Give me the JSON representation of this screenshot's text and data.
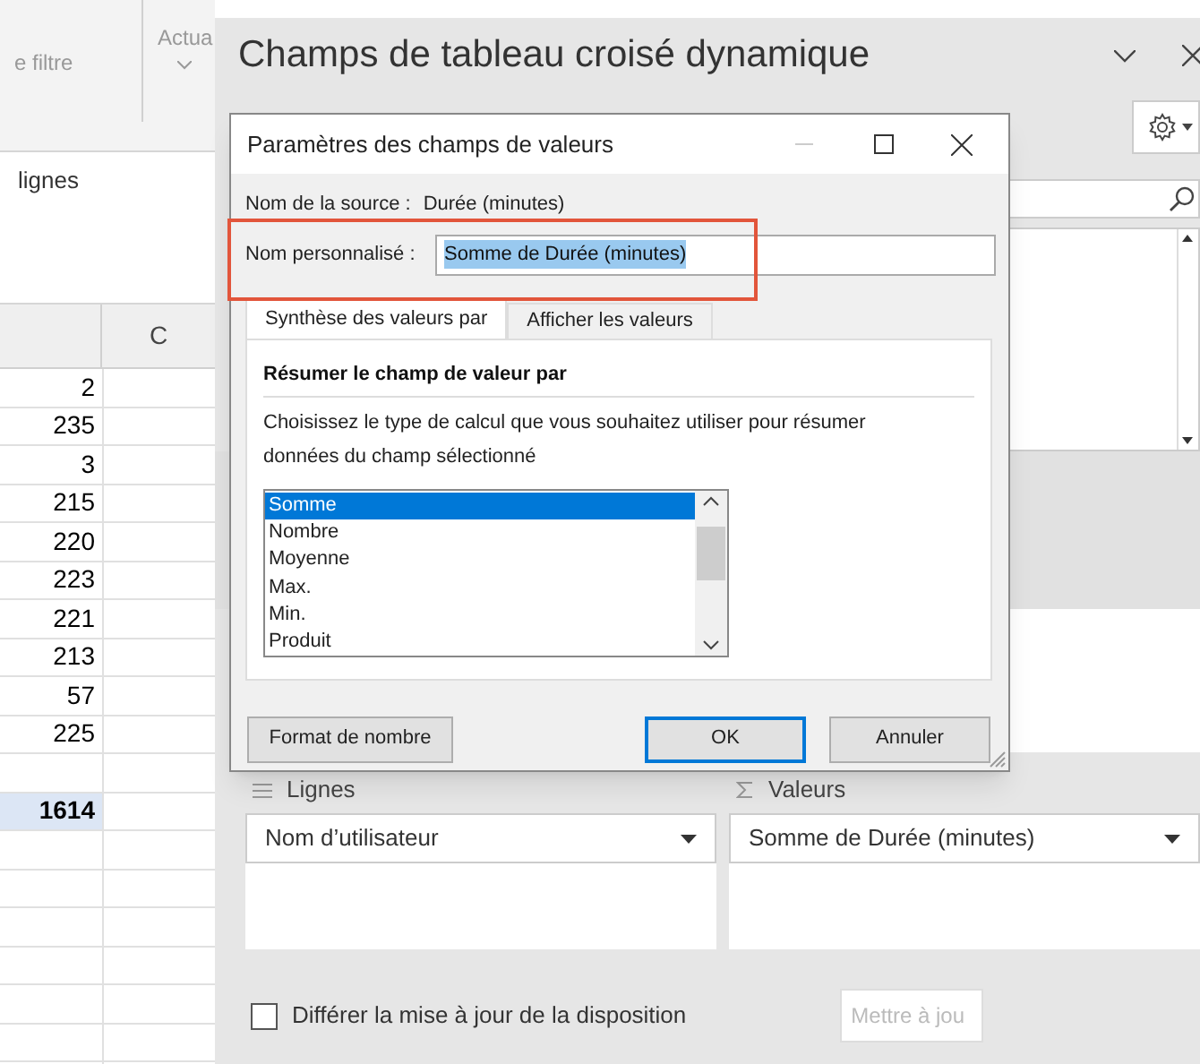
{
  "ribbon": {
    "items": [
      {
        "kind": "text",
        "label": "e filtre"
      },
      {
        "kind": "dropdown",
        "label": "Actua"
      }
    ]
  },
  "sheet": {
    "label": "lignes",
    "column_header": "C",
    "rows": [
      "2",
      "235",
      "3",
      "215",
      "220",
      "223",
      "221",
      "213",
      "57",
      "225"
    ],
    "total": "1614"
  },
  "pivot_pane": {
    "title": "Champs de tableau croisé dynamique",
    "areas": [
      {
        "kind": "rows",
        "header": "Lignes",
        "field": "Nom d’utilisateur"
      },
      {
        "kind": "values",
        "header": "Valeurs",
        "field": "Somme de Durée (minutes)"
      }
    ],
    "defer": {
      "label": "Différer la mise à jour de la disposition",
      "checked": false
    },
    "update_button": {
      "label": "Mettre à jou",
      "disabled": true
    }
  },
  "dialog": {
    "title": "Paramètres des champs de valeurs",
    "source_label": "Nom de la source :",
    "source_value": "Durée (minutes)",
    "custom_label": "Nom personnalisé :",
    "custom_value": "Somme de Durée (minutes)",
    "tabs": [
      {
        "label": "Synthèse des valeurs par",
        "selected": true
      },
      {
        "label": "Afficher les valeurs",
        "selected": false
      }
    ],
    "heading": "Résumer le champ de valeur par",
    "description": "Choisissez le type de calcul que vous souhaitez utiliser pour résumer données du champ sélectionné",
    "functions": [
      {
        "label": "Somme",
        "selected": true
      },
      {
        "label": "Nombre",
        "selected": false
      },
      {
        "label": "Moyenne",
        "selected": false
      },
      {
        "label": "Max.",
        "selected": false
      },
      {
        "label": "Min.",
        "selected": false
      },
      {
        "label": "Produit",
        "selected": false
      }
    ],
    "buttons": [
      {
        "kind": "format",
        "label": "Format de nombre"
      },
      {
        "kind": "ok",
        "label": "OK"
      },
      {
        "kind": "cancel",
        "label": "Annuler"
      }
    ]
  }
}
